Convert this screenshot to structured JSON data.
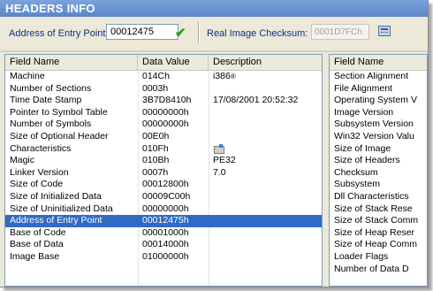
{
  "title": "HEADERS INFO",
  "entry_point": {
    "label": "Address of Entry Point:",
    "value": "00012475"
  },
  "checksum": {
    "label": "Real Image Checksum:",
    "value": "0001D7FCh"
  },
  "left_table": {
    "columns": [
      "Field Name",
      "Data Value",
      "Description"
    ],
    "rows": [
      {
        "field": "Machine",
        "value": "014Ch",
        "desc": "i386"
      },
      {
        "field": "Number of Sections",
        "value": "0003h",
        "desc": ""
      },
      {
        "field": "Time Date Stamp",
        "value": "3B7D8410h",
        "desc": "17/08/2001  20:52:32"
      },
      {
        "field": "Pointer to Symbol Table",
        "value": "00000000h",
        "desc": ""
      },
      {
        "field": "Number of Symbols",
        "value": "00000000h",
        "desc": ""
      },
      {
        "field": "Size of Optional Header",
        "value": "00E0h",
        "desc": ""
      },
      {
        "field": "Characteristics",
        "value": "010Fh",
        "desc": ""
      },
      {
        "field": "Magic",
        "value": "010Bh",
        "desc": "PE32"
      },
      {
        "field": "Linker Version",
        "value": "0007h",
        "desc": "7.0"
      },
      {
        "field": "Size of Code",
        "value": "00012800h",
        "desc": ""
      },
      {
        "field": "Size of Initialized Data",
        "value": "00009C00h",
        "desc": ""
      },
      {
        "field": "Size of Uninitialized Data",
        "value": "00000000h",
        "desc": ""
      },
      {
        "field": "Address of Entry Point",
        "value": "00012475h",
        "desc": ""
      },
      {
        "field": "Base of Code",
        "value": "00001000h",
        "desc": ""
      },
      {
        "field": "Base of Data",
        "value": "00014000h",
        "desc": ""
      },
      {
        "field": "Image Base",
        "value": "01000000h",
        "desc": ""
      }
    ],
    "selected_row": "Address of Entry Point",
    "reg_mark": "®"
  },
  "right_table": {
    "columns": [
      "Field Name"
    ],
    "rows": [
      "Section Alignment",
      "File Alignment",
      "Operating System V",
      "Image Version",
      "Subsystem Version",
      "Win32 Version Valu",
      "Size of Image",
      "Size of Headers",
      "Checksum",
      "Subsystem",
      "Dll Characteristics",
      "Size of Stack Rese",
      "Size of Stack Comm",
      "Size of Heap Reser",
      "Size of Heap Comm",
      "Loader Flags",
      "Number of Data D"
    ]
  },
  "icons": {
    "check": "checkmark-icon",
    "calc": "calculator-icon",
    "characteristics": "flags-icon"
  },
  "colors": {
    "title_bg": "#5a86c8",
    "label_text": "#0b2f8a",
    "selection": "#316ac5",
    "check": "#2f9a2f"
  }
}
